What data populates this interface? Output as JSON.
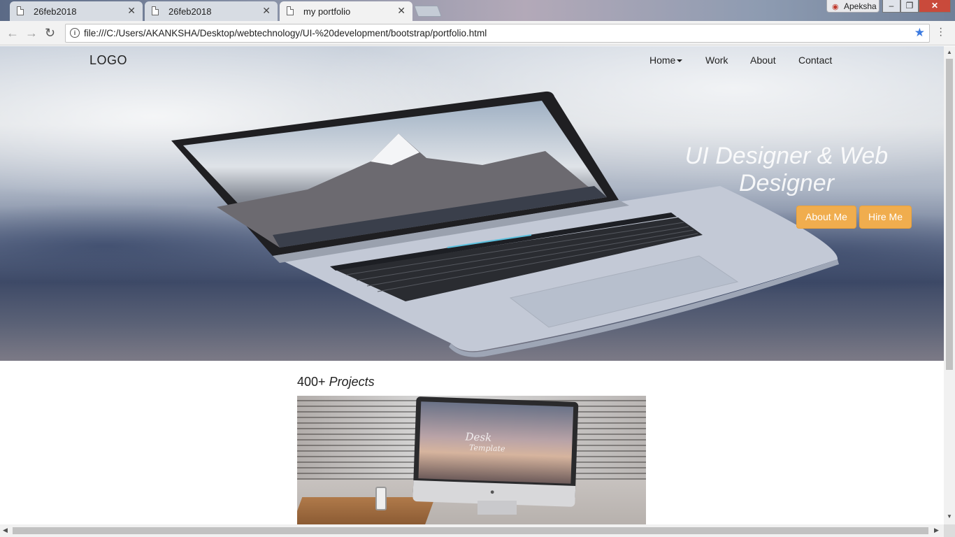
{
  "browser": {
    "tabs": [
      {
        "title": "26feb2018",
        "active": false
      },
      {
        "title": "26feb2018",
        "active": false
      },
      {
        "title": "my portfolio",
        "active": true
      }
    ],
    "tab_close": "✕",
    "profile_name": "Apeksha",
    "url": "file:///C:/Users/AKANKSHA/Desktop/webtechnology/UI-%20development/bootstrap/portfolio.html",
    "window_buttons": {
      "minimize": "–",
      "restore": "❐",
      "close": "✕"
    }
  },
  "site": {
    "logo": "LOGO",
    "nav": [
      {
        "label": "Home",
        "has_dropdown": true
      },
      {
        "label": "Work"
      },
      {
        "label": "About"
      },
      {
        "label": "Contact"
      }
    ],
    "hero": {
      "headline_line1": "UI Designer & Web",
      "headline_line2": "Designer",
      "buttons": {
        "about": "About Me",
        "hire": "Hire Me"
      }
    },
    "projects": {
      "count": "400+",
      "label": "Projects",
      "image_brand_line1": "Desk",
      "image_brand_line2": "Template"
    }
  },
  "colors": {
    "accent_button": "#f0ad4e",
    "bookmark_star": "#3b7ae0"
  }
}
